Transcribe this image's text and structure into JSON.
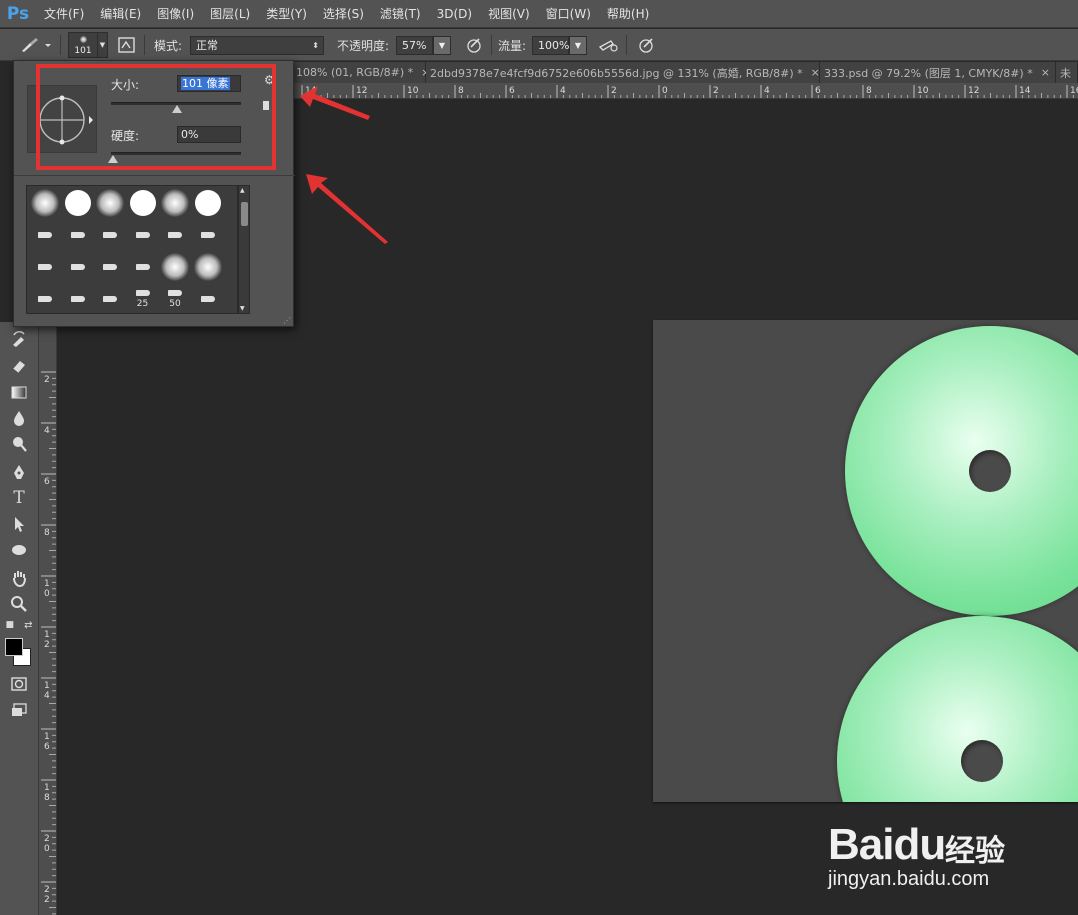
{
  "app": {
    "logo": "Ps"
  },
  "menu": [
    "文件(F)",
    "编辑(E)",
    "图像(I)",
    "图层(L)",
    "类型(Y)",
    "选择(S)",
    "滤镜(T)",
    "3D(D)",
    "视图(V)",
    "窗口(W)",
    "帮助(H)"
  ],
  "options": {
    "brush_size": "101",
    "mode_label": "模式:",
    "mode_value": "正常",
    "opacity_label": "不透明度:",
    "opacity_value": "57%",
    "flow_label": "流量:",
    "flow_value": "100%"
  },
  "tabs": [
    {
      "label": "108% (01, RGB/8#) *",
      "close": "×"
    },
    {
      "label": "2dbd9378e7e4fcf9d6752e606b5556d.jpg @ 131% (高婚, RGB/8#) *",
      "close": "×"
    },
    {
      "label": "333.psd @ 79.2% (图层 1, CMYK/8#) *",
      "close": "×"
    },
    {
      "label": "未",
      "close": ""
    }
  ],
  "ruler": {
    "h_ticks": [
      "14",
      "12",
      "10",
      "8",
      "6",
      "4",
      "2",
      "0",
      "2",
      "4",
      "6",
      "8",
      "10",
      "12",
      "14",
      "16"
    ],
    "v_ticks": [
      "2",
      "4",
      "6",
      "8",
      "1 0",
      "1 2",
      "1 4",
      "1 6",
      "1 8",
      "2 0",
      "2 2"
    ]
  },
  "brush_panel": {
    "size_label": "大小:",
    "size_value": "101 像素",
    "hardness_label": "硬度:",
    "hardness_value": "0%",
    "size_level_percent": 51,
    "hardness_level_percent": 0,
    "presets": [
      {
        "kind": "soft",
        "label": ""
      },
      {
        "kind": "hard",
        "label": ""
      },
      {
        "kind": "soft",
        "label": ""
      },
      {
        "kind": "hard",
        "label": ""
      },
      {
        "kind": "soft",
        "label": ""
      },
      {
        "kind": "hard",
        "label": ""
      },
      {
        "kind": "tip",
        "label": ""
      },
      {
        "kind": "tip",
        "label": ""
      },
      {
        "kind": "tip",
        "label": ""
      },
      {
        "kind": "tip",
        "label": ""
      },
      {
        "kind": "tip",
        "label": ""
      },
      {
        "kind": "tip",
        "label": ""
      },
      {
        "kind": "tip",
        "label": ""
      },
      {
        "kind": "tip",
        "label": ""
      },
      {
        "kind": "tip",
        "label": ""
      },
      {
        "kind": "tip",
        "label": ""
      },
      {
        "kind": "soft",
        "label": ""
      },
      {
        "kind": "soft",
        "label": ""
      },
      {
        "kind": "tip",
        "label": ""
      },
      {
        "kind": "tip",
        "label": ""
      },
      {
        "kind": "tip",
        "label": ""
      },
      {
        "kind": "tip",
        "label": "25"
      },
      {
        "kind": "tip",
        "label": "50"
      },
      {
        "kind": "tip",
        "label": ""
      }
    ]
  },
  "watermark": {
    "logo": "Baidu",
    "cn": "经验",
    "url": "jingyan.baidu.com"
  },
  "colors": {
    "annotation": "#e23232",
    "jade": "#7be39c"
  }
}
